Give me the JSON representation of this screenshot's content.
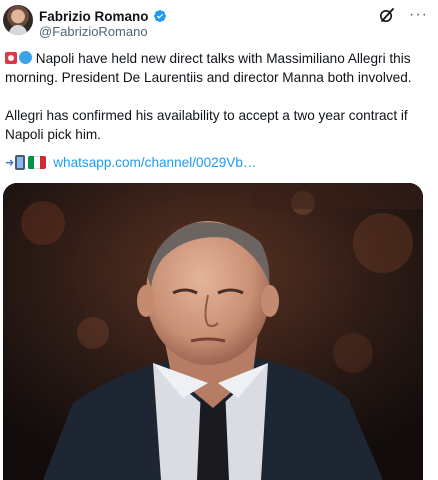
{
  "author": {
    "display_name": "Fabrizio Romano",
    "handle": "@FabrizioRomano"
  },
  "icons": {
    "verified": "verified-badge-icon",
    "grok": "grok-icon",
    "more": "more-options-icon"
  },
  "actions": {
    "more_label": "···"
  },
  "tweet": {
    "para1": "Napoli have held new direct talks with Massimiliano Allegri this morning. President De Laurentiis and director Manna both involved.",
    "para2": "Allegri has confirmed his availability to accept a two year contract if Napoli pick him.",
    "link_text": "whatsapp.com/channel/0029Vb…"
  },
  "colors": {
    "link": "#1d9bf0",
    "verified": "#1d9bf0",
    "text": "#0f1419",
    "secondary": "#536471"
  }
}
